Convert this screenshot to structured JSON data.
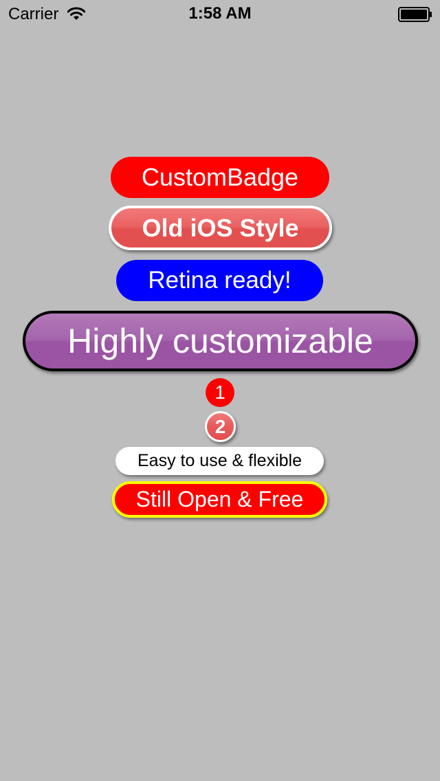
{
  "status_bar": {
    "carrier": "Carrier",
    "time": "1:58 AM",
    "wifi_icon": "wifi-icon",
    "battery_icon": "battery-full-icon"
  },
  "colors": {
    "background": "#bdbdbd",
    "badge_red": "#ff0000",
    "badge_blue": "#0000ff",
    "badge_purple": "#a05aa8",
    "old_ios_red": "#e85a5a",
    "frame_white": "#ffffff",
    "frame_black": "#000000",
    "frame_yellow": "#ffff00"
  },
  "badges": [
    {
      "text": "CustomBadge"
    },
    {
      "text": "Old iOS Style"
    },
    {
      "text": "Retina ready!"
    },
    {
      "text": "Highly customizable"
    },
    {
      "text": "1"
    },
    {
      "text": "2"
    },
    {
      "text": "Easy to use & flexible"
    },
    {
      "text": "Still Open & Free"
    }
  ]
}
